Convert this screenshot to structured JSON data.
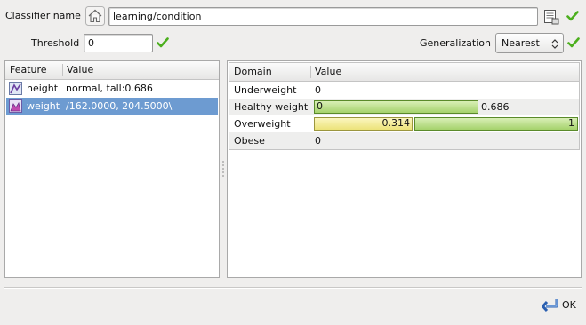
{
  "top": {
    "classifier_label": "Classifier name",
    "classifier_value": "learning/condition",
    "threshold_label": "Threshold",
    "threshold_value": "0",
    "generalization_label": "Generalization",
    "generalization_value": "Nearest"
  },
  "features": {
    "headers": [
      "Feature",
      "Value"
    ],
    "rows": [
      {
        "name": "height",
        "value": "normal, tall:0.686",
        "selected": false
      },
      {
        "name": "weight",
        "value": "/162.0000, 204.5000\\",
        "selected": true
      }
    ]
  },
  "domain": {
    "headers": [
      "Domain",
      "Value"
    ],
    "rows": [
      {
        "name": "Underweight",
        "value": "0"
      },
      {
        "name": "Healthy weight",
        "bar_left_label": "0",
        "bar_value": 0.686,
        "value": "0.686"
      },
      {
        "name": "Overweight",
        "yellow_value": 0.314,
        "yellow_label": "0.314",
        "green_value": 1,
        "green_label": "1"
      },
      {
        "name": "Obese",
        "value": "0"
      }
    ]
  },
  "footer": {
    "ok_label": "OK"
  },
  "colors": {
    "selection": "#6d9bd1",
    "check_green": "#4caf1e"
  }
}
